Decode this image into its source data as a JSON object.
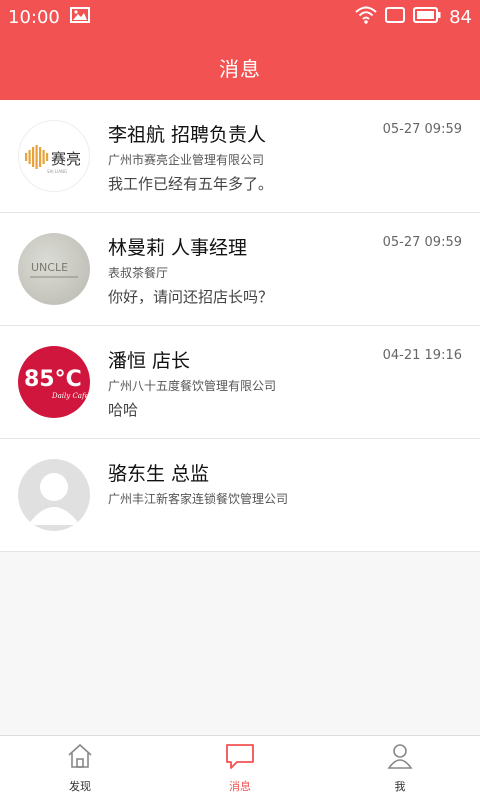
{
  "status_bar": {
    "time": "10:00",
    "battery": "84"
  },
  "header": {
    "title": "消息"
  },
  "messages": [
    {
      "name": "李祖航 招聘负责人",
      "time": "05-27 09:59",
      "company": "广州市赛亮企业管理有限公司",
      "preview": "我工作已经有五年多了。",
      "avatar_text": "赛亮",
      "avatar_subtext": "SAI LIANG"
    },
    {
      "name": "林曼莉 人事经理",
      "time": "05-27 09:59",
      "company": "表叔茶餐厅",
      "preview": " 你好，请问还招店长吗？",
      "avatar_text": "UNCLE"
    },
    {
      "name": "潘恒 店长",
      "time": "04-21 19:16",
      "company": "广州八十五度餐饮管理有限公司",
      "preview": "哈哈",
      "avatar_text": "85°C",
      "avatar_subtext": "Daily Cafe"
    },
    {
      "name": "骆东生 总监",
      "time": "",
      "company": "广州丰江新客家连锁餐饮管理公司",
      "preview": ""
    }
  ],
  "nav": {
    "items": [
      {
        "label": "发现",
        "icon": "home-icon"
      },
      {
        "label": "消息",
        "icon": "message-icon",
        "active": true
      },
      {
        "label": "我",
        "icon": "person-icon"
      }
    ]
  },
  "colors": {
    "accent": "#f25252",
    "avatar_red": "#d0163c"
  }
}
